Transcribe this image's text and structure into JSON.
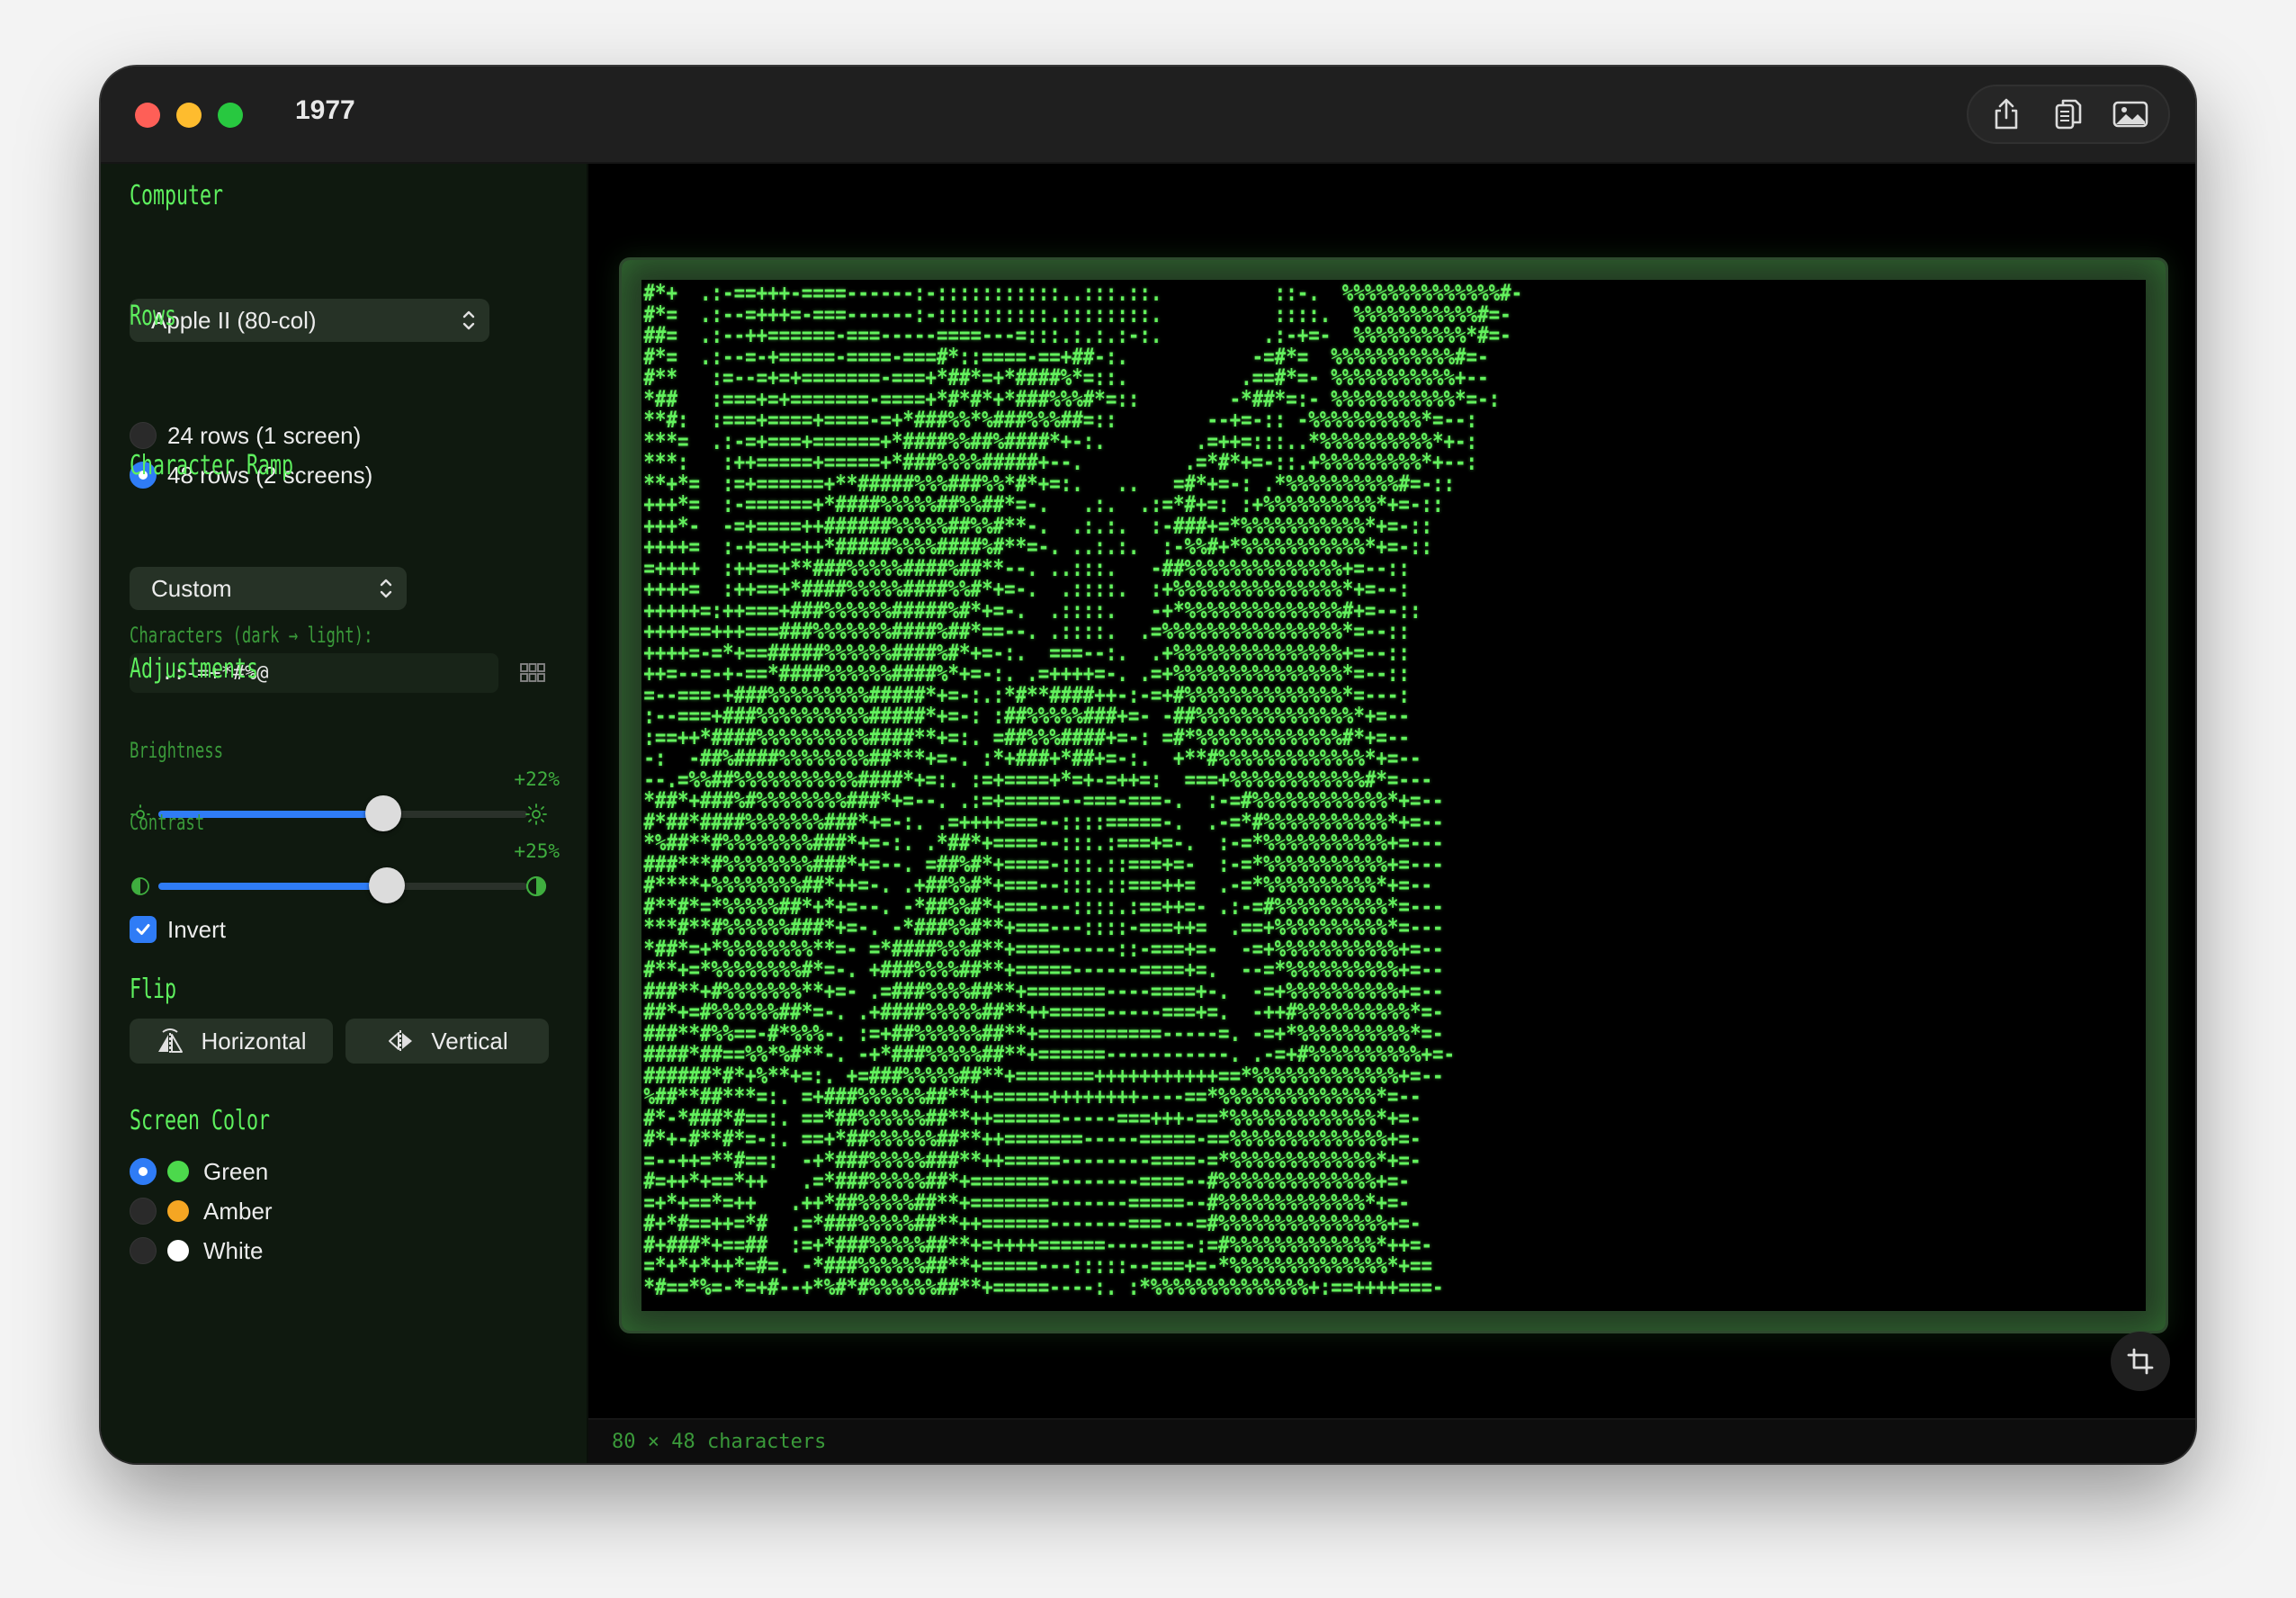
{
  "window": {
    "title": "1977"
  },
  "toolbar": {
    "share_icon": "share-icon",
    "copy_icon": "copy-icon",
    "image_icon": "image-icon"
  },
  "sidebar": {
    "computer": {
      "label": "Computer",
      "selected": "Apple II (80-col)"
    },
    "rows": {
      "label": "Rows",
      "options": [
        {
          "label": "24 rows (1 screen)",
          "selected": false
        },
        {
          "label": "48 rows (2 screens)",
          "selected": true
        }
      ]
    },
    "ramp": {
      "label": "Character Ramp",
      "selected": "Custom",
      "chars_label": "Characters (dark → light):",
      "chars_value": " .:-=+*#%@"
    },
    "adjustments": {
      "label": "Adjustments",
      "brightness": {
        "label": "Brightness",
        "value_text": "+22%",
        "level": 0.61
      },
      "contrast": {
        "label": "Contrast",
        "value_text": "+25%",
        "level": 0.62
      },
      "invert": {
        "label": "Invert",
        "checked": true
      }
    },
    "flip": {
      "label": "Flip",
      "horizontal": "Horizontal",
      "vertical": "Vertical"
    },
    "screen_color": {
      "label": "Screen Color",
      "options": [
        {
          "label": "Green",
          "color": "#4cd94c",
          "selected": true
        },
        {
          "label": "Amber",
          "color": "#f5a623",
          "selected": false
        },
        {
          "label": "White",
          "color": "#ffffff",
          "selected": false
        }
      ]
    }
  },
  "preview": {
    "ascii": "#*+  .:-==+++-====------:-:::::::::::..:::.::.          ::-.  %%%%%%%%%%%%%%#-\n#*=  .:--=+++=-===------:-::::::::::.::::::::.          ::::.  %%%%%%%%%%%#=-\n##=  .:--++======-===-----====---=:::.:.:.:-:.         .:-+=-  %%%%%%%%%%*#=-\n#*=  .:--=-+=====-====-===#*::====-==+##-:.           -=#*=  %%%%%%%%%%%#=-\n#**   :=--=+=+=======-===+*##*=+*####%*=::.          .==#*=- %%%%%%%%%%%+--\n*##   :===+=+=======-====+*#*#*+*###%%%#*=::        -*##*=:- %%%%%%%%%%%*=-:\n**#:  :===+====+====-=+*###%%*%###%%%##=::        --+=-:: -%%%%%%%%%%*=--:\n***=  .:-=+===+======+*####%%##%####*+-:.        .=++=:::..*%%%%%%%%%%*+-:\n***:   :++=====+=====+*###%%%%#####+--.         .=*#*+=-::.+%%%%%%%%%*+--:\n**+*=  :=+======+**#####%%%###%%*#*+=:.   ..   =#*+=-: .*%%%%%%%%%%#=-::\n+++*=  :-======+*####%%%%%##%%##*=-.   .:.  .:=*#+=: :+%%%%%%%%%%*+=-::\n+++*-  -=+====++######%%%%%##%%#**-.  .:.:.  :-###+=*%%%%%%%%%%%*+=-::\n++++=  :-+==+=++*#####%%%%####%#**=-. ..:.:.  :-%%#+*%%%%%%%%%%%*+=-::\n=++++  :++==+**###%%%%%####%##**--. ..:::.   -##%%%%%%%%%%%%%%+=--::\n++++=  :++==+*####%%%%%####%%#*+=-.  .::::.  :+%%%%%%%%%%%%%%%*+=--:\n+++++=:++===+###%%%%%%#####%#*+=-.  .::::.   -+*%%%%%%%%%%%%%%#+=--::\n++++==+++===###%%%%%%%####%##*==--. .::::.  .=%%%%%%%%%%%%%%%%*=--::\n++++=-=*+==#####%%%%%%####%#*+=-:.  ===--:.  .+%%%%%%%%%%%%%%%+=--::\n++=--=-+-==*####%%%%%%####%*+=-:. .=++++=-. .=+%%%%%%%%%%%%%%%*=--::\n=--===-+###%%%%%%%%%#####*+=-:.:*#**####++-:-=+#%%%%%%%%%%%%%%*=---:\n:--===+###%%%%%%%%%%#####*+=-: :##%%%%%###+=- -##%%%%%%%%%%%%%%*+=--\n:==++*####%%%%%%%%%%####**+=:. =##%%%####+=-: =#*%%%%%%%%%%%%%#*+=--\n-:  -##%####%%%%%%%%##***+=-. :*+###+*##+=-:.  +**#%%%%%%%%%%%%%*+=--\n--.=%%##%%%%%%%%%%%####*+=:. :=+====+*=+-=++=:  ===+%%%%%%%%%%%%#*=---\n*##*+###%#%%%%%%%%###*+=--. .:=+=====--===-===-.  :-=#%%%%%%%%%%%%*+=--\n#*##*####%%%%%%%###*+=-:. .=++++===--::::=====-.  .-=*#%%%%%%%%%%%*+=--\n*%##**#%%%%%%%%###*+=-:. .*##*+====--:::.:===+=-.  :-=*%%%%%%%%%%%+=---\n###***#%%%%%%%%###*+=--. =##%#*+====-:::.::===+=-  :-=*%%%%%%%%%%%+=---\n#****+%%%%%%%%##*++=-. .+##%%#*+===--:::.::===++=  .-=*%%%%%%%%%%*+=--\n#**#*=*%%%%%##*+*+=--. -*##%%#*+===---::::.:==++=- .:-=#%%%%%%%%%%*=---\n***#**#%%%%%%###*+=-. -*###%%#**+===---::::-===++=  .==+%%%%%%%%%%*=---\n*##*=+*%%%%%%%%**=- =*####%%%#**+====-----::-===+=-  -=+%%%%%%%%%%%+=--\n#**+=*%%%%%%%%#*=-. +###%%%%##**+=====------====+=.  --=*%%%%%%%%%%+=--\n###**+#%%%%%%%**+=- .=###%%%%##**+=======----====+-.  -=+%%%%%%%%%%+=--\n##*+=#%%%%%%##*=-. .+####%%%%%##**++=====-----===+=.  -++#%%%%%%%%%%*=-\n###**#%%==-#*%%%-. :=+##%%%%%%##**+===========-----=. -=+*%%%%%%%%%%*=-\n####*##==%%*%#**-. -+*###%%%%%##**+======-----------. .-=+#%%%%%%%%%%+=-\n######*#*+%**+=:. +=###%%%%%##**+=======+++++++++++==*%%%%%%%%%%%%%+=--\n%##**##***=:. =+###%%%%%%##**++=====++++++++----==*%%%%%%%%%%%%%%*=--\n#*-*###*#==:. ==*##%%%%%%##**++======-----===+++-==*%%%%%%%%%%%%%*+=-\n#*+-#**#*=-:. ==+*##%%%%%%##**++=======-----=====-==%%%%%%%%%%%%%%+=-\n=--++=**#==:  -+*###%%%%%###**++=====--------====-=*%%%%%%%%%%%%%*+=-\n#=++*+==*++   .=*###%%%%%##*+=======--------====--#%%%%%%%%%%%%%%+=-\n=+*+==*=++   .++*##%%%%%##**+=======-------=====--#%%%%%%%%%%%%%*+=-\n#+*#==++=*#  .=*###%%%%%##**++======-------===---=#%%%%%%%%%%%%%%%+=-\n#+###*+==##  :=+*###%%%%%##**+=++++======----===-:=#%%%%%%%%%%%%%*++=-\n=*+*+*++*=#=. -*###%%%%%%##**+=====---:::::--===+=-*%%%%%%%%%%%%%%*+==\n*#==*%=-*=+#--+*%#*#%%%%%%##**+=====----:. :*%%%%%%%%%%%%%%+:==++++===-"
  },
  "status": {
    "text": "80 × 48 characters"
  },
  "crop_icon": "crop-icon"
}
